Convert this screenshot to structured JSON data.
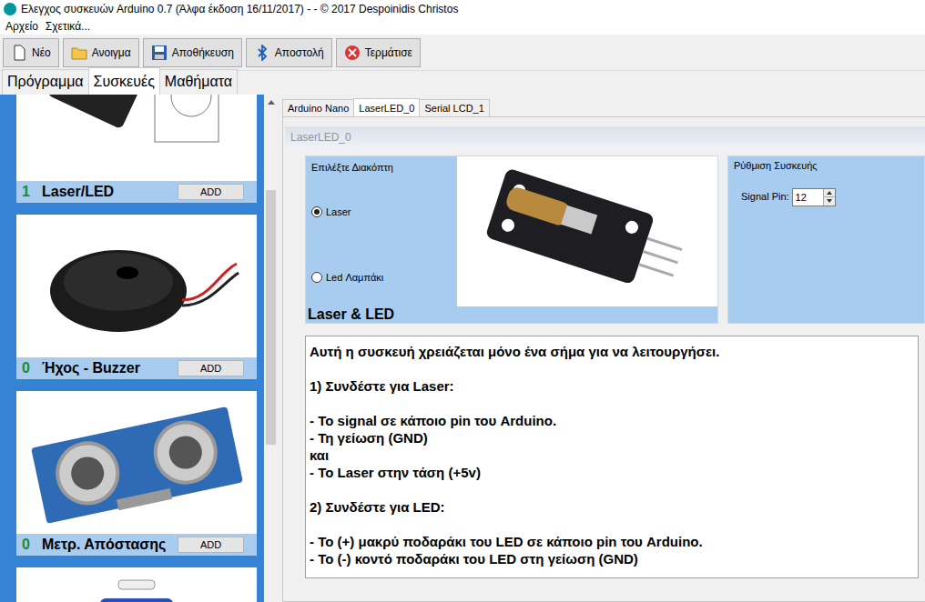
{
  "window": {
    "title": "Ελεγχος συσκευών Arduino 0.7 (Άλφα έκδοση 16/11/2017)  -  - © 2017 Despoinidis Christos"
  },
  "menu": [
    "Αρχείο",
    "Σχετικά..."
  ],
  "toolbar": [
    "Νέο",
    "Ανοιγμα",
    "Αποθήκευση",
    "Αποστολή",
    "Τερμάτισε"
  ],
  "main_tabs": [
    {
      "label": "Πρόγραμμα",
      "selected": false
    },
    {
      "label": "Συσκευές",
      "selected": true
    },
    {
      "label": "Μαθήματα",
      "selected": false
    }
  ],
  "devices": [
    {
      "count": "1",
      "name": "Laser/LED",
      "button": "ADD"
    },
    {
      "count": "0",
      "name": "Ήχος - Buzzer",
      "button": "ADD"
    },
    {
      "count": "0",
      "name": "Μετρ. Απόστασης",
      "button": "ADD"
    }
  ],
  "device_tabs": [
    {
      "label": "Arduino Nano",
      "selected": false
    },
    {
      "label": "LaserLED_0",
      "selected": true
    },
    {
      "label": "Serial LCD_1",
      "selected": false
    }
  ],
  "panel": {
    "title": "LaserLED_0",
    "switch_title": "Επιλέξτε Διακόπτη",
    "options": [
      {
        "label": "Laser",
        "selected": true
      },
      {
        "label": "Led Λαμπάκι",
        "selected": false
      }
    ],
    "device_label": "Laser & LED",
    "settings_title": "Ρύθμιση Συσκευής",
    "pin_label": "Signal Pin:",
    "pin_value": "12"
  },
  "instructions": [
    [
      "Αυτή η συσκευή χρειάζεται μόνο ένα σήμα για να λειτουργήσει."
    ],
    [
      "1) Συνδέστε για Laser:"
    ],
    [
      "- Το signal σε κάποιο pin του Arduino.",
      "- Τη γείωση (GND)",
      "και",
      "- Το Laser στην τάση (+5v)"
    ],
    [
      "2) Συνδέστε για LED:"
    ],
    [
      "- Το (+) μακρύ ποδαράκι του LED σε κάποιο pin του Arduino.",
      "- Το (-) κοντό ποδαράκι του LED στη γείωση (GND)"
    ]
  ]
}
